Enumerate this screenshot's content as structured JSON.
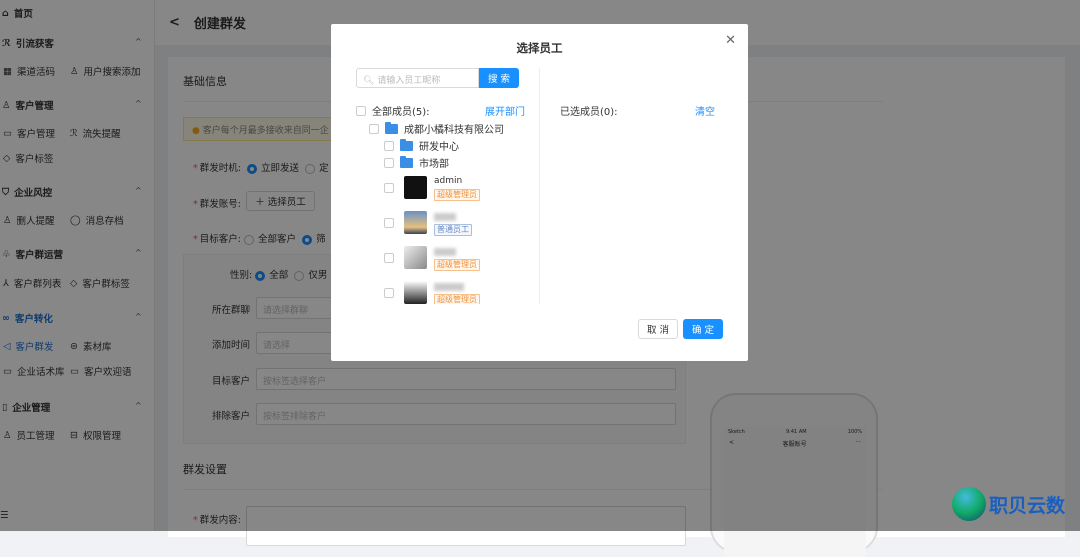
{
  "sidebar": {
    "home": "首页",
    "groups": [
      {
        "label": "引流获客",
        "items": [
          "渠道活码",
          "用户搜索添加"
        ]
      },
      {
        "label": "客户管理",
        "items": [
          "客户管理",
          "流失提醒",
          "客户标签"
        ]
      },
      {
        "label": "企业风控",
        "items": [
          "删人提醒",
          "消息存档"
        ]
      },
      {
        "label": "客户群运营",
        "items": [
          "客户群列表",
          "客户群标签"
        ]
      },
      {
        "label": "客户转化",
        "items": [
          "客户群发",
          "素材库",
          "企业话术库",
          "客户欢迎语"
        ]
      },
      {
        "label": "企业管理",
        "items": [
          "员工管理",
          "权限管理"
        ]
      }
    ],
    "active_color": "#1e6fd0"
  },
  "header": {
    "title": "创建群发"
  },
  "form": {
    "section1": "基础信息",
    "notice": "客户每个月最多接收来自同一企",
    "timing_label": "群发时机",
    "timing_options": [
      "立即发送",
      "定"
    ],
    "account_label": "群发账号",
    "select_staff": "选择员工",
    "target_label": "目标客户",
    "target_options": [
      "全部客户",
      "筛"
    ],
    "gender_label": "性别",
    "gender_options": [
      "全部",
      "仅男"
    ],
    "group_label": "所在群聊",
    "group_placeholder": "请选择群聊",
    "time_label": "添加时间",
    "time_placeholder": "请选择",
    "tag_label": "目标客户",
    "tag_placeholder": "按标签选择客户",
    "exclude_label": "排除客户",
    "exclude_placeholder": "按标签排除客户",
    "section2": "群发设置",
    "content_label": "群发内容"
  },
  "phone": {
    "carrier": "Sketch",
    "time": "9:41 AM",
    "battery": "100%",
    "title": "客服账号"
  },
  "watermark": "职贝云数",
  "modal": {
    "title": "选择员工",
    "search_placeholder": "请输入员工昵称",
    "search_button": "搜 索",
    "all_members": "全部成员(5):",
    "expand": "展开部门",
    "company": "成都小橘科技有限公司",
    "depts": [
      "研发中心",
      "市场部"
    ],
    "members": [
      {
        "name": "admin",
        "role": "超级管理员",
        "type": "admin"
      },
      {
        "name": "",
        "role": "普通员工",
        "type": "normal"
      },
      {
        "name": "",
        "role": "超级管理员",
        "type": "admin"
      },
      {
        "name": "",
        "role": "超级管理员",
        "type": "admin"
      }
    ],
    "selected": "已选成员(0):",
    "clear": "清空",
    "cancel": "取 消",
    "confirm": "确 定",
    "primary_color": "#1890ff"
  }
}
